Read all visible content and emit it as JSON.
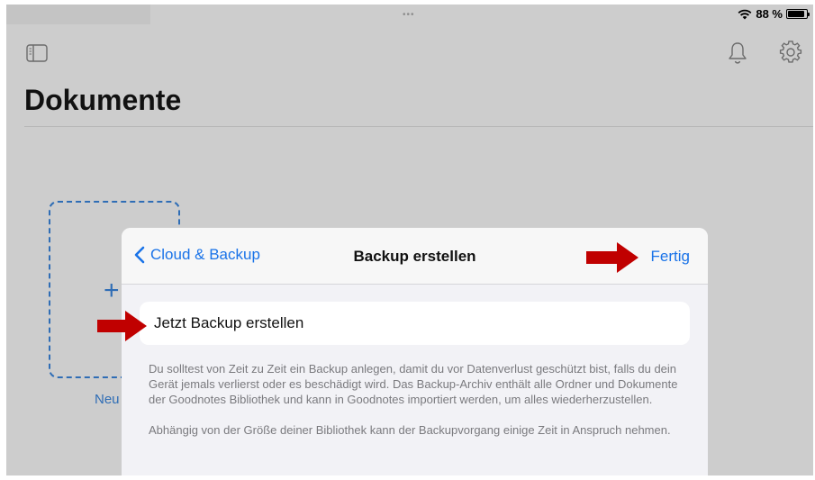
{
  "status_bar": {
    "battery_text": "88 %",
    "battery_level": 0.88,
    "multitask_dots": "•••"
  },
  "toolbar": {
    "icons": [
      "sidebar-icon",
      "bell-icon",
      "gear-icon"
    ]
  },
  "page": {
    "title": "Dokumente",
    "new_document_label": "Neu",
    "new_document_symbol": "+"
  },
  "modal": {
    "back_label": "Cloud & Backup",
    "title": "Backup erstellen",
    "done_label": "Fertig",
    "action_label": "Jetzt Backup erstellen",
    "description": [
      "Du solltest von Zeit zu Zeit ein Backup anlegen, damit du vor Datenverlust geschützt bist, falls du dein Gerät jemals verlierst oder es beschädigt wird. Das Backup-Archiv enthält alle Ordner und Dokumente der Goodnotes Bibliothek und kann in Goodnotes importiert werden, um alles wiederherzustellen.",
      "Abhängig von der Größe deiner Bibliothek kann der Backupvorgang einige Zeit in Anspruch nehmen."
    ]
  },
  "colors": {
    "accent": "#1a73e8",
    "annotation_arrow": "#c00000",
    "background": "#cdcdcd"
  }
}
